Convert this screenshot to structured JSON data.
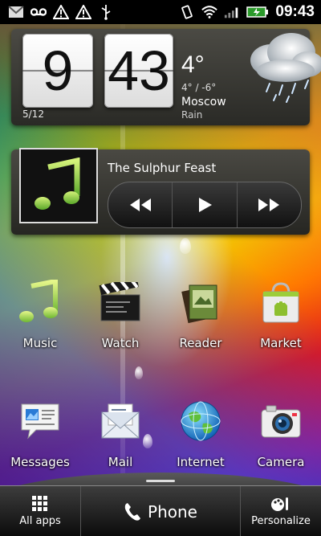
{
  "status_bar": {
    "time": "09:43",
    "left_icons": [
      "gmail-icon",
      "voicemail-icon",
      "warning-icon",
      "warning-icon",
      "usb-icon"
    ],
    "right_icons": [
      "vibrate-icon",
      "wifi-icon",
      "signal-icon",
      "battery-charging-icon"
    ]
  },
  "clock_widget": {
    "hour": "9",
    "minute": "43",
    "date": "5/12",
    "temperature": "4°",
    "range": "4° / -6°",
    "city": "Moscow",
    "condition": "Rain"
  },
  "music_widget": {
    "song_title": "The Sulphur Feast"
  },
  "apps": [
    {
      "label": "Music",
      "icon": "music-note-icon"
    },
    {
      "label": "Watch",
      "icon": "clapperboard-icon"
    },
    {
      "label": "Reader",
      "icon": "book-icon"
    },
    {
      "label": "Market",
      "icon": "market-bag-icon"
    },
    {
      "label": "Messages",
      "icon": "messages-icon"
    },
    {
      "label": "Mail",
      "icon": "mail-envelope-icon"
    },
    {
      "label": "Internet",
      "icon": "globe-icon"
    },
    {
      "label": "Camera",
      "icon": "camera-icon"
    }
  ],
  "dock": {
    "all_apps_label": "All apps",
    "phone_label": "Phone",
    "personalize_label": "Personalize"
  },
  "colors": {
    "widget_bg": "#3a3934",
    "dock_bg": "#1a1a1a",
    "music_green": "#8cc63f"
  }
}
